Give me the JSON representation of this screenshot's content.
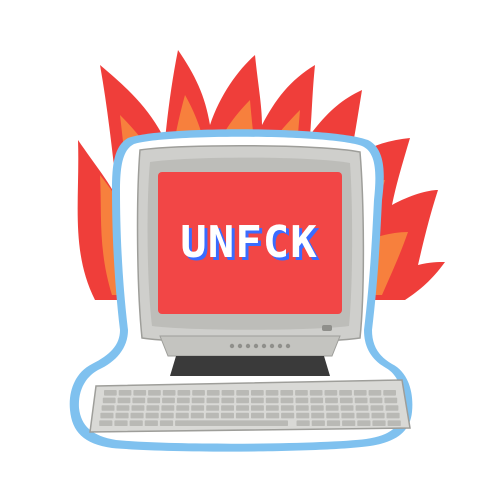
{
  "screen": {
    "text": "UNFCK"
  },
  "colors": {
    "background": "#ffffff",
    "flame_outer": "#ef3e3a",
    "flame_mid": "#f7803d",
    "flame_inner": "#ffd2a8",
    "outline_blue": "#7fc1ef",
    "screen_red": "#f24646",
    "screen_text": "#ffffff",
    "text_shadow_blue": "#3a6cff",
    "bezel": "#cfcfcc",
    "bezel_dark": "#a8a8a4",
    "keyboard": "#d9d9d6",
    "keys": "#b9b9b5"
  }
}
